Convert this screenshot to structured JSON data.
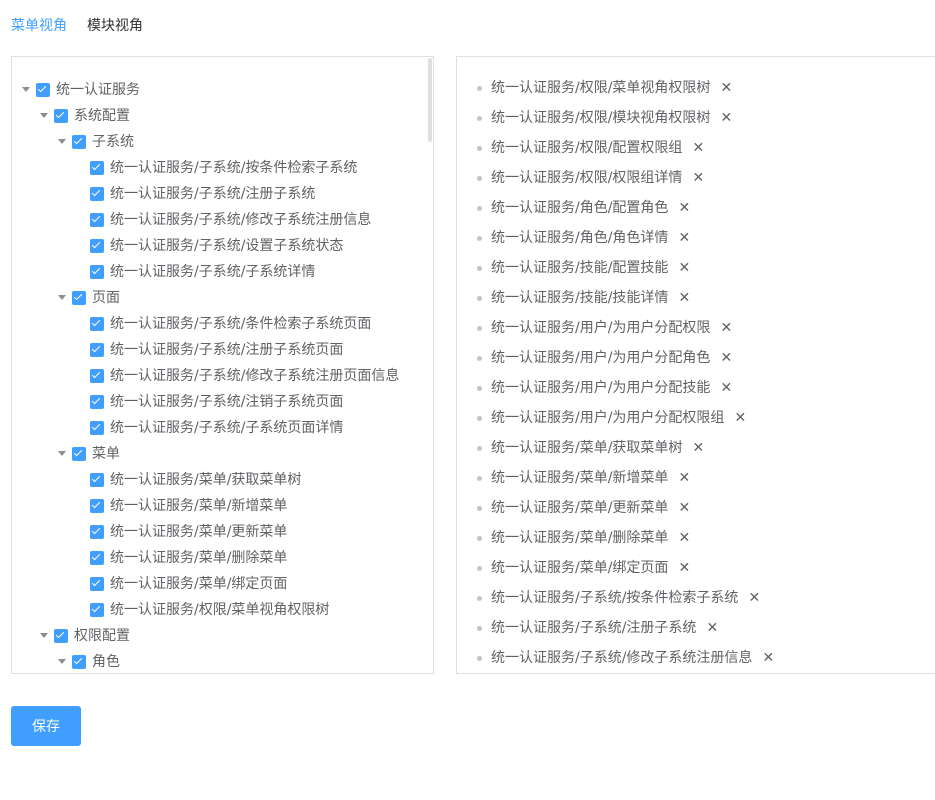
{
  "tabs": [
    {
      "label": "菜单视角",
      "active": true
    },
    {
      "label": "模块视角",
      "active": false
    }
  ],
  "tree": [
    {
      "label": "统一认证服务",
      "level": 0,
      "expandable": true,
      "checked": true
    },
    {
      "label": "系统配置",
      "level": 1,
      "expandable": true,
      "checked": true
    },
    {
      "label": "子系统",
      "level": 2,
      "expandable": true,
      "checked": true
    },
    {
      "label": "统一认证服务/子系统/按条件检索子系统",
      "level": 3,
      "expandable": false,
      "checked": true
    },
    {
      "label": "统一认证服务/子系统/注册子系统",
      "level": 3,
      "expandable": false,
      "checked": true
    },
    {
      "label": "统一认证服务/子系统/修改子系统注册信息",
      "level": 3,
      "expandable": false,
      "checked": true
    },
    {
      "label": "统一认证服务/子系统/设置子系统状态",
      "level": 3,
      "expandable": false,
      "checked": true
    },
    {
      "label": "统一认证服务/子系统/子系统详情",
      "level": 3,
      "expandable": false,
      "checked": true
    },
    {
      "label": "页面",
      "level": 2,
      "expandable": true,
      "checked": true
    },
    {
      "label": "统一认证服务/子系统/条件检索子系统页面",
      "level": 3,
      "expandable": false,
      "checked": true
    },
    {
      "label": "统一认证服务/子系统/注册子系统页面",
      "level": 3,
      "expandable": false,
      "checked": true
    },
    {
      "label": "统一认证服务/子系统/修改子系统注册页面信息",
      "level": 3,
      "expandable": false,
      "checked": true
    },
    {
      "label": "统一认证服务/子系统/注销子系统页面",
      "level": 3,
      "expandable": false,
      "checked": true
    },
    {
      "label": "统一认证服务/子系统/子系统页面详情",
      "level": 3,
      "expandable": false,
      "checked": true
    },
    {
      "label": "菜单",
      "level": 2,
      "expandable": true,
      "checked": true
    },
    {
      "label": "统一认证服务/菜单/获取菜单树",
      "level": 3,
      "expandable": false,
      "checked": true
    },
    {
      "label": "统一认证服务/菜单/新增菜单",
      "level": 3,
      "expandable": false,
      "checked": true
    },
    {
      "label": "统一认证服务/菜单/更新菜单",
      "level": 3,
      "expandable": false,
      "checked": true
    },
    {
      "label": "统一认证服务/菜单/删除菜单",
      "level": 3,
      "expandable": false,
      "checked": true
    },
    {
      "label": "统一认证服务/菜单/绑定页面",
      "level": 3,
      "expandable": false,
      "checked": true
    },
    {
      "label": "统一认证服务/权限/菜单视角权限树",
      "level": 3,
      "expandable": false,
      "checked": true
    },
    {
      "label": "权限配置",
      "level": 1,
      "expandable": true,
      "checked": true
    },
    {
      "label": "角色",
      "level": 2,
      "expandable": true,
      "checked": true
    }
  ],
  "selected_items": [
    "统一认证服务/权限/菜单视角权限树",
    "统一认证服务/权限/模块视角权限树",
    "统一认证服务/权限/配置权限组",
    "统一认证服务/权限/权限组详情",
    "统一认证服务/角色/配置角色",
    "统一认证服务/角色/角色详情",
    "统一认证服务/技能/配置技能",
    "统一认证服务/技能/技能详情",
    "统一认证服务/用户/为用户分配权限",
    "统一认证服务/用户/为用户分配角色",
    "统一认证服务/用户/为用户分配技能",
    "统一认证服务/用户/为用户分配权限组",
    "统一认证服务/菜单/获取菜单树",
    "统一认证服务/菜单/新增菜单",
    "统一认证服务/菜单/更新菜单",
    "统一认证服务/菜单/删除菜单",
    "统一认证服务/菜单/绑定页面",
    "统一认证服务/子系统/按条件检索子系统",
    "统一认证服务/子系统/注册子系统",
    "统一认证服务/子系统/修改子系统注册信息"
  ],
  "close_glyph": "✕",
  "save_button": "保存",
  "colors": {
    "accent": "#409eff",
    "text": "#606266",
    "border": "#dcdfe6"
  }
}
